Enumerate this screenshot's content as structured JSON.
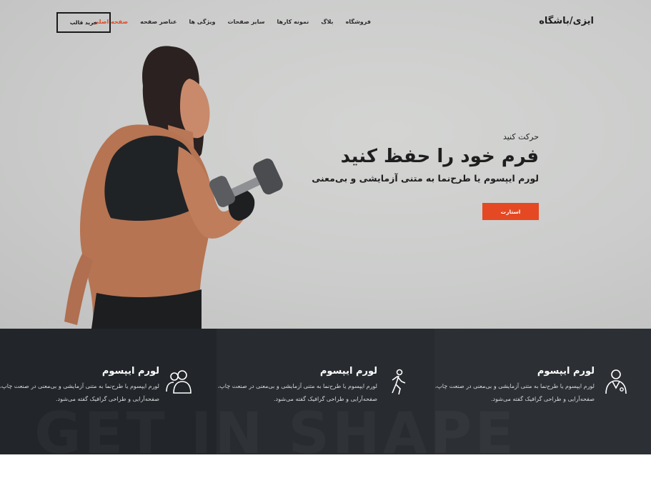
{
  "header": {
    "logo": "ایزی/باشگاه",
    "nav": [
      {
        "label": "صفحه اصلی",
        "active": true
      },
      {
        "label": "عناصر صفحه",
        "active": false
      },
      {
        "label": "ویژگی ها",
        "active": false
      },
      {
        "label": "سایر صفحات",
        "active": false
      },
      {
        "label": "نمونه کارها",
        "active": false
      },
      {
        "label": "بلاگ",
        "active": false
      },
      {
        "label": "فروشگاه",
        "active": false
      }
    ],
    "buy_button": "خرید قالب"
  },
  "hero": {
    "kicker": "حرکت کنید",
    "headline": "فرم خود را حفظ کنید",
    "subline": "لورم ایپسوم یا طرح‌نما به متنی آزمایشی و بی‌معنی",
    "cta": "استارت"
  },
  "features": {
    "watermark": "GET IN SHAPE",
    "items": [
      {
        "title": "لورم ایپسوم",
        "icon": "doctor-icon",
        "text": "لورم ایپسوم یا طرح‌نما به متنی آزمایشی و بی‌معنی در صنعت چاپ، صفحه‌آرایی و طراحی گرافیک گفته می‌شود."
      },
      {
        "title": "لورم ایپسوم",
        "icon": "walking-person-icon",
        "text": "لورم ایپسوم یا طرح‌نما به متنی آزمایشی و بی‌معنی در صنعت چاپ، صفحه‌آرایی و طراحی گرافیک گفته می‌شود."
      },
      {
        "title": "لورم ایپسوم",
        "icon": "users-icon",
        "text": "لورم ایپسوم یا طرح‌نما به متنی آزمایشی و بی‌معنی در صنعت چاپ، صفحه‌آرایی و طراحی گرافیک گفته می‌شود."
      }
    ]
  },
  "colors": {
    "accent": "#e44923",
    "dark_band": "#23262b",
    "hero_bg": "#cbcccb"
  }
}
